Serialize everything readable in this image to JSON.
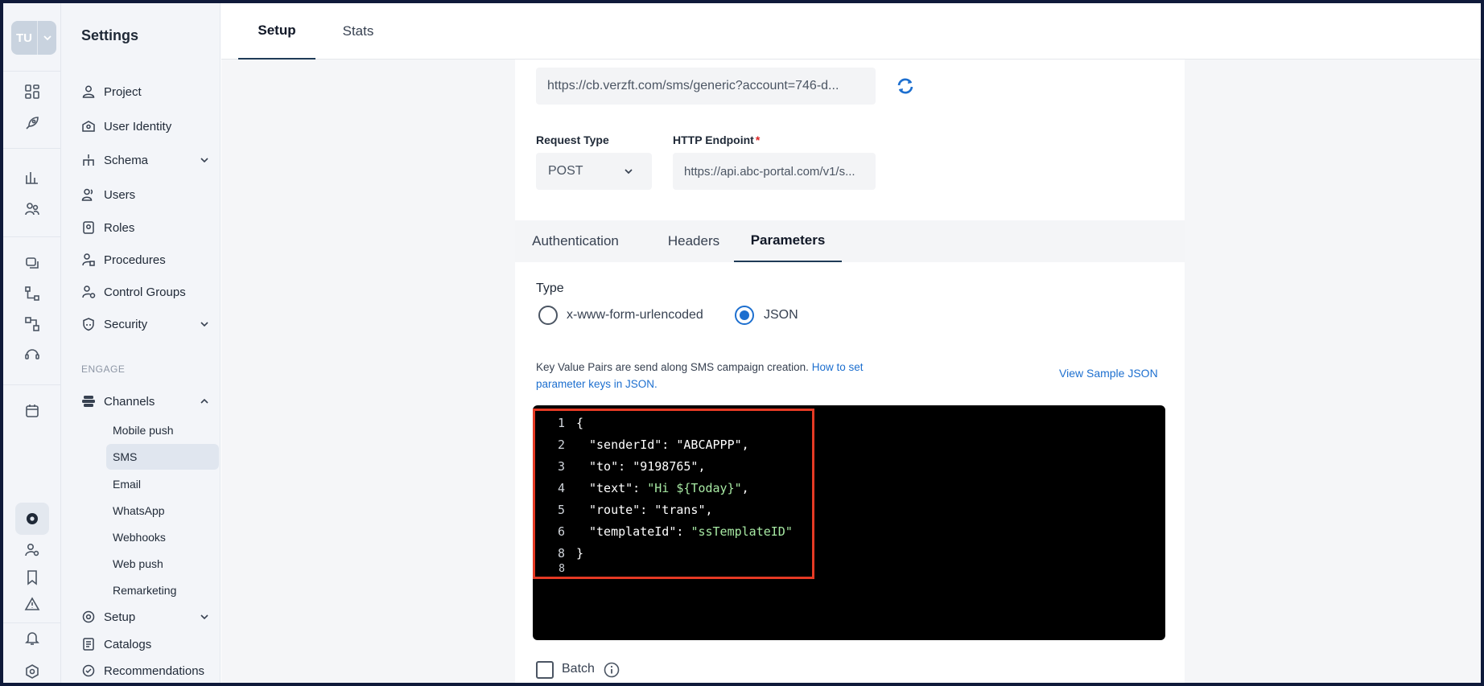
{
  "user": {
    "initials": "TU"
  },
  "sidebar": {
    "title": "Settings",
    "items": [
      {
        "label": "Project",
        "icon": "person-icon"
      },
      {
        "label": "User Identity",
        "icon": "id-card-icon"
      },
      {
        "label": "Schema",
        "icon": "schema-icon",
        "expandable": true
      },
      {
        "label": "Users",
        "icon": "users-icon"
      },
      {
        "label": "Roles",
        "icon": "roles-icon"
      },
      {
        "label": "Procedures",
        "icon": "procedures-icon"
      },
      {
        "label": "Control Groups",
        "icon": "control-groups-icon"
      },
      {
        "label": "Security",
        "icon": "shield-icon",
        "expandable": true
      }
    ],
    "section_label": "ENGAGE",
    "channels": {
      "label": "Channels",
      "children": [
        "Mobile push",
        "SMS",
        "Email",
        "WhatsApp",
        "Webhooks",
        "Web push",
        "Remarketing"
      ],
      "active": "SMS"
    },
    "bottom_items": [
      {
        "label": "Setup",
        "icon": "gear-icon",
        "expandable": true
      },
      {
        "label": "Catalogs",
        "icon": "catalog-icon"
      },
      {
        "label": "Recommendations",
        "icon": "recommendations-icon"
      }
    ]
  },
  "top_tabs": [
    "Setup",
    "Stats"
  ],
  "form": {
    "callback_url": "https://cb.verzft.com/sms/generic?account=746-d...",
    "request_type_label": "Request Type",
    "request_type_value": "POST",
    "endpoint_label": "HTTP Endpoint",
    "endpoint_required": "*",
    "endpoint_value": "https://api.abc-portal.com/v1/s..."
  },
  "sub_tabs": [
    "Authentication",
    "Headers",
    "Parameters"
  ],
  "params": {
    "type_label": "Type",
    "options": [
      "x-www-form-urlencoded",
      "JSON"
    ],
    "selected": "JSON",
    "info_text": "Key Value Pairs are send along SMS campaign creation.",
    "info_link": "How to set parameter keys in JSON.",
    "view_sample": "View Sample JSON"
  },
  "editor": {
    "lines": [
      {
        "num": "1",
        "code": "{"
      },
      {
        "num": "2",
        "key": "\"senderId\": ",
        "val": "\"ABCAPPP\"",
        "tail": ","
      },
      {
        "num": "3",
        "key": "\"to\": ",
        "val": "\"9198765\"",
        "tail": ","
      },
      {
        "num": "4",
        "key": "\"text\": ",
        "val": "\"Hi ${Today}\"",
        "tail": ","
      },
      {
        "num": "5",
        "key": "\"route\": ",
        "val": "\"trans\"",
        "tail": ","
      },
      {
        "num": "6",
        "key": "\"templateId\": ",
        "val": "\"ssTemplateID\"",
        "tail": ""
      },
      {
        "num": "8",
        "code": "}"
      },
      {
        "num": "8",
        "code": ""
      }
    ]
  },
  "batch_label": "Batch",
  "colors": {
    "accent": "#1d6fcf",
    "highlight": "#e53a24",
    "editor_bg": "#000000"
  }
}
